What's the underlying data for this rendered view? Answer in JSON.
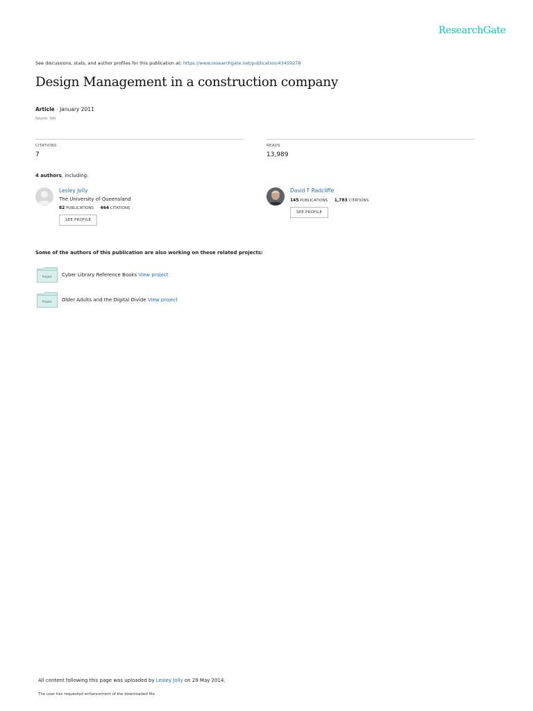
{
  "brand": {
    "logo_text": "ResearchGate",
    "accent_color": "#00ccbb",
    "link_color": "#1a6fb3"
  },
  "header": {
    "see_discussions_text": "See discussions, stats, and author profiles for this publication at:",
    "publication_url": "https://www.researchgate.net/publication/43459278"
  },
  "publication": {
    "title": "Design Management in a construction company",
    "type": "Article",
    "date": "January 2011",
    "source": "Source: OAI"
  },
  "stats": {
    "citations_label": "CITATIONS",
    "citations_value": "7",
    "reads_label": "READS",
    "reads_value": "13,989"
  },
  "authors_section": {
    "count_text": "4 authors",
    "suffix_text": ", including:",
    "authors": [
      {
        "name": "Lesley Jolly",
        "institution": "The University of Queensland",
        "publications_count": "82",
        "publications_label": "PUBLICATIONS",
        "citations_count": "464",
        "citations_label": "CITATIONS",
        "button_label": "SEE PROFILE",
        "avatar": "placeholder-avatar-icon"
      },
      {
        "name": "David F Radcliffe",
        "institution": "",
        "publications_count": "145",
        "publications_label": "PUBLICATIONS",
        "citations_count": "1,783",
        "citations_label": "CITATIONS",
        "button_label": "SEE PROFILE",
        "avatar": "photo-avatar"
      }
    ]
  },
  "projects_section": {
    "heading": "Some of the authors of this publication are also working on these related projects:",
    "folder_label": "Project",
    "projects": [
      {
        "name": "Cyber Library Reference Books",
        "link_text": "View project"
      },
      {
        "name": "Older Adults and the Digital Divide",
        "link_text": "View project"
      }
    ]
  },
  "footer": {
    "uploaded_prefix": "All content following this page was uploaded by",
    "uploader": "Lesley Jolly",
    "uploaded_suffix": "on 29 May 2014.",
    "enhancement_note": "The user has requested enhancement of the downloaded file."
  }
}
